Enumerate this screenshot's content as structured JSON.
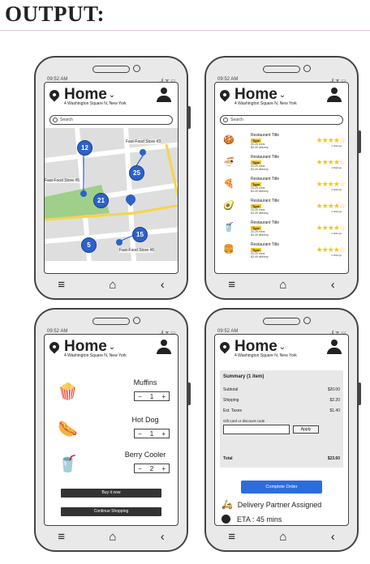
{
  "header": {
    "title": "OUTPUT:"
  },
  "common": {
    "time": "09:52 AM",
    "status_icons": ".ıl ᯤ ▭",
    "home": "Home",
    "address": "4 Washington Square N, New York",
    "search_placeholder": "Search"
  },
  "map": {
    "labels": [
      "Fast-Food Store #3",
      "Fast-Food Store #5",
      "Fast-Food Store #6"
    ],
    "clusters": [
      "12",
      "25",
      "21",
      "15",
      "5"
    ]
  },
  "restaurants": {
    "title": "Restaurant Title",
    "type": "Type",
    "mins": "20-25 mins",
    "delivery": "$3.49 delivery",
    "stars": "★★★★☆",
    "ratings": "4 Ratings",
    "icons": [
      "cookie-icon",
      "bowl-icon",
      "pizza-icon",
      "avocado-icon",
      "drink-icon",
      "burger-icon"
    ]
  },
  "cart": {
    "items": [
      {
        "name": "Muffins",
        "qty": "1"
      },
      {
        "name": "Hot Dog",
        "qty": "1"
      },
      {
        "name": "Berry Cooler",
        "qty": "2"
      }
    ],
    "buy_now": "Buy it now",
    "continue": "Continue Shopping"
  },
  "summary": {
    "title": "Summary (1 item)",
    "rows": [
      {
        "label": "Subtotal",
        "value": "$20.00"
      },
      {
        "label": "Shipping",
        "value": "$2.20"
      },
      {
        "label": "Est. Taxes",
        "value": "$1.40"
      }
    ],
    "gift_label": "Gift card or discount code",
    "apply": "Apply",
    "total_label": "Total",
    "total_value": "$23.60",
    "complete_order": "Complete Order",
    "delivery": "Delivery Partner Assigned",
    "eta": "ETA : 45 mins"
  },
  "colors": {
    "accent": "#2d6ce0",
    "star": "#f5c518",
    "road": "#f4d54a",
    "park": "#9fcf8a"
  }
}
